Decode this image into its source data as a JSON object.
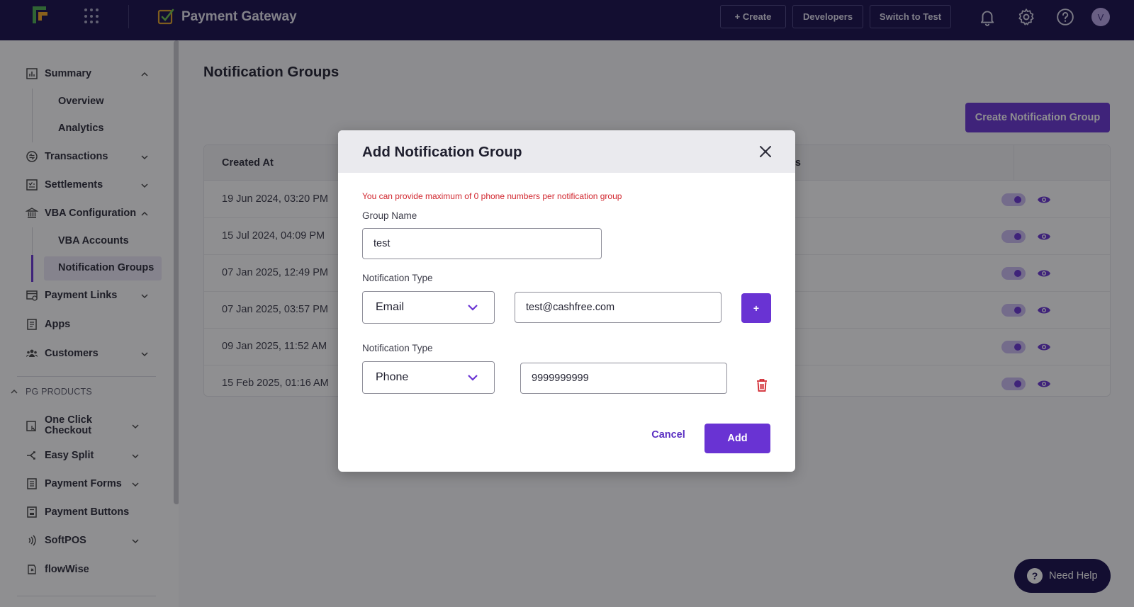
{
  "topbar": {
    "app_title": "Payment Gateway",
    "create_label": "+ Create",
    "developers_label": "Developers",
    "switch_label": "Switch to Test",
    "avatar_initial": "V",
    "icons": [
      "app-logo-icon",
      "apps-grid-icon",
      "payment-gateway-icon",
      "bell-icon",
      "gear-icon",
      "help-icon"
    ]
  },
  "sidebar": {
    "summary": "Summary",
    "overview": "Overview",
    "analytics": "Analytics",
    "transactions": "Transactions",
    "settlements": "Settlements",
    "vba_configuration": "VBA Configuration",
    "vba_accounts": "VBA Accounts",
    "notification_groups": "Notification Groups",
    "payment_links": "Payment Links",
    "apps": "Apps",
    "customers": "Customers",
    "pg_products": "PG PRODUCTS",
    "one_click_checkout_line1": "One Click",
    "one_click_checkout_line2": "Checkout",
    "easy_split": "Easy Split",
    "payment_forms": "Payment Forms",
    "payment_buttons": "Payment Buttons",
    "softpos": "SoftPOS",
    "flowwise": "flowWise"
  },
  "main": {
    "page_title": "Notification Groups",
    "create_button": "Create Notification Group",
    "table": {
      "col_created_at": "Created At",
      "col_status_partial": "us",
      "rows": [
        {
          "created_at": "19 Jun 2024, 03:20 PM"
        },
        {
          "created_at": "15 Jul 2024, 04:09 PM"
        },
        {
          "created_at": "07 Jan 2025, 12:49 PM"
        },
        {
          "created_at": "07 Jan 2025, 03:57 PM"
        },
        {
          "created_at": "09 Jan 2025, 11:52 AM"
        },
        {
          "created_at": "15 Feb 2025, 01:16 AM"
        }
      ]
    },
    "help_button": "Need Help"
  },
  "modal": {
    "title": "Add Notification Group",
    "warning": "You can provide maximum of 0 phone numbers per notification group",
    "group_name_label": "Group Name",
    "group_name_value": "test",
    "notification_type_label": "Notification Type",
    "rows": [
      {
        "type": "Email",
        "value": "test@cashfree.com"
      },
      {
        "type": "Phone",
        "value": "9999999999"
      }
    ],
    "plus_label": "+",
    "cancel_label": "Cancel",
    "add_label": "Add"
  },
  "colors": {
    "topbar_bg": "#150c4a",
    "accent": "#6933d3",
    "warning": "#d1262e"
  }
}
